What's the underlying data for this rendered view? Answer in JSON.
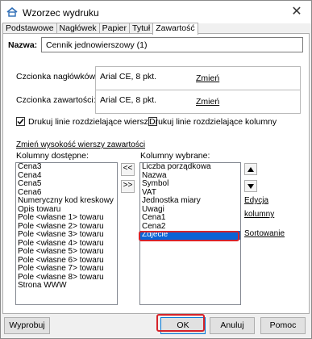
{
  "window": {
    "title": "Wzorzec wydruku",
    "close_glyph": "✕"
  },
  "tabs": [
    {
      "label": "Podstawowe",
      "active": false
    },
    {
      "label": "Nagłówek",
      "active": false
    },
    {
      "label": "Papier",
      "active": false
    },
    {
      "label": "Tytuł",
      "active": false
    },
    {
      "label": "Zawartość",
      "active": true
    }
  ],
  "name_field": {
    "label": "Nazwa:",
    "value": "Cennik jednowierszowy (1)"
  },
  "header_font": {
    "label": "Czcionka nagłówków:",
    "value": "Arial CE, 8 pkt.",
    "change_link": "Zmień"
  },
  "content_font": {
    "label": "Czcionka zawartości:",
    "value": "Arial CE, 8 pkt.",
    "change_link": "Zmień"
  },
  "options": {
    "print_row_lines": {
      "label": "Drukuj linie rozdzielające wiersze",
      "checked": true
    },
    "print_col_lines": {
      "label": "Drukuj linie rozdzielające kolumny",
      "checked": false
    }
  },
  "row_height_link": "Zmień wysokość wierszy zawartości",
  "available_columns": {
    "label": "Kolumny dostępne:",
    "items": [
      "Cena3",
      "Cena4",
      "Cena5",
      "Cena6",
      "Numeryczny kod kreskowy",
      "Opis towaru",
      "Pole <własne 1> towaru",
      "Pole <własne 2> towaru",
      "Pole <własne 3> towaru",
      "Pole <własne 4> towaru",
      "Pole <własne 5> towaru",
      "Pole <własne 6> towaru",
      "Pole <własne 7> towaru",
      "Pole <własne 8> towaru",
      "Strona WWW"
    ]
  },
  "selected_columns": {
    "label": "Kolumny wybrane:",
    "items": [
      "Liczba porządkowa",
      "Nazwa",
      "Symbol",
      "VAT",
      "Jednostka miary",
      "Uwagi",
      "Cena1",
      "Cena2",
      "Zdjecie"
    ],
    "selected_index": 8
  },
  "move_buttons": {
    "move_left": "<<",
    "move_right": ">>"
  },
  "side_links": {
    "edit_columns_line1": "Edycja",
    "edit_columns_line2": "kolumny",
    "sorting": "Sortowanie"
  },
  "footer": {
    "print_button": "Wyprobuj",
    "ok_button": "OK",
    "cancel_button": "Anuluj",
    "help_button": "Pomoc"
  },
  "colors": {
    "selection": "#0b63d6",
    "highlight": "#d6232a"
  }
}
